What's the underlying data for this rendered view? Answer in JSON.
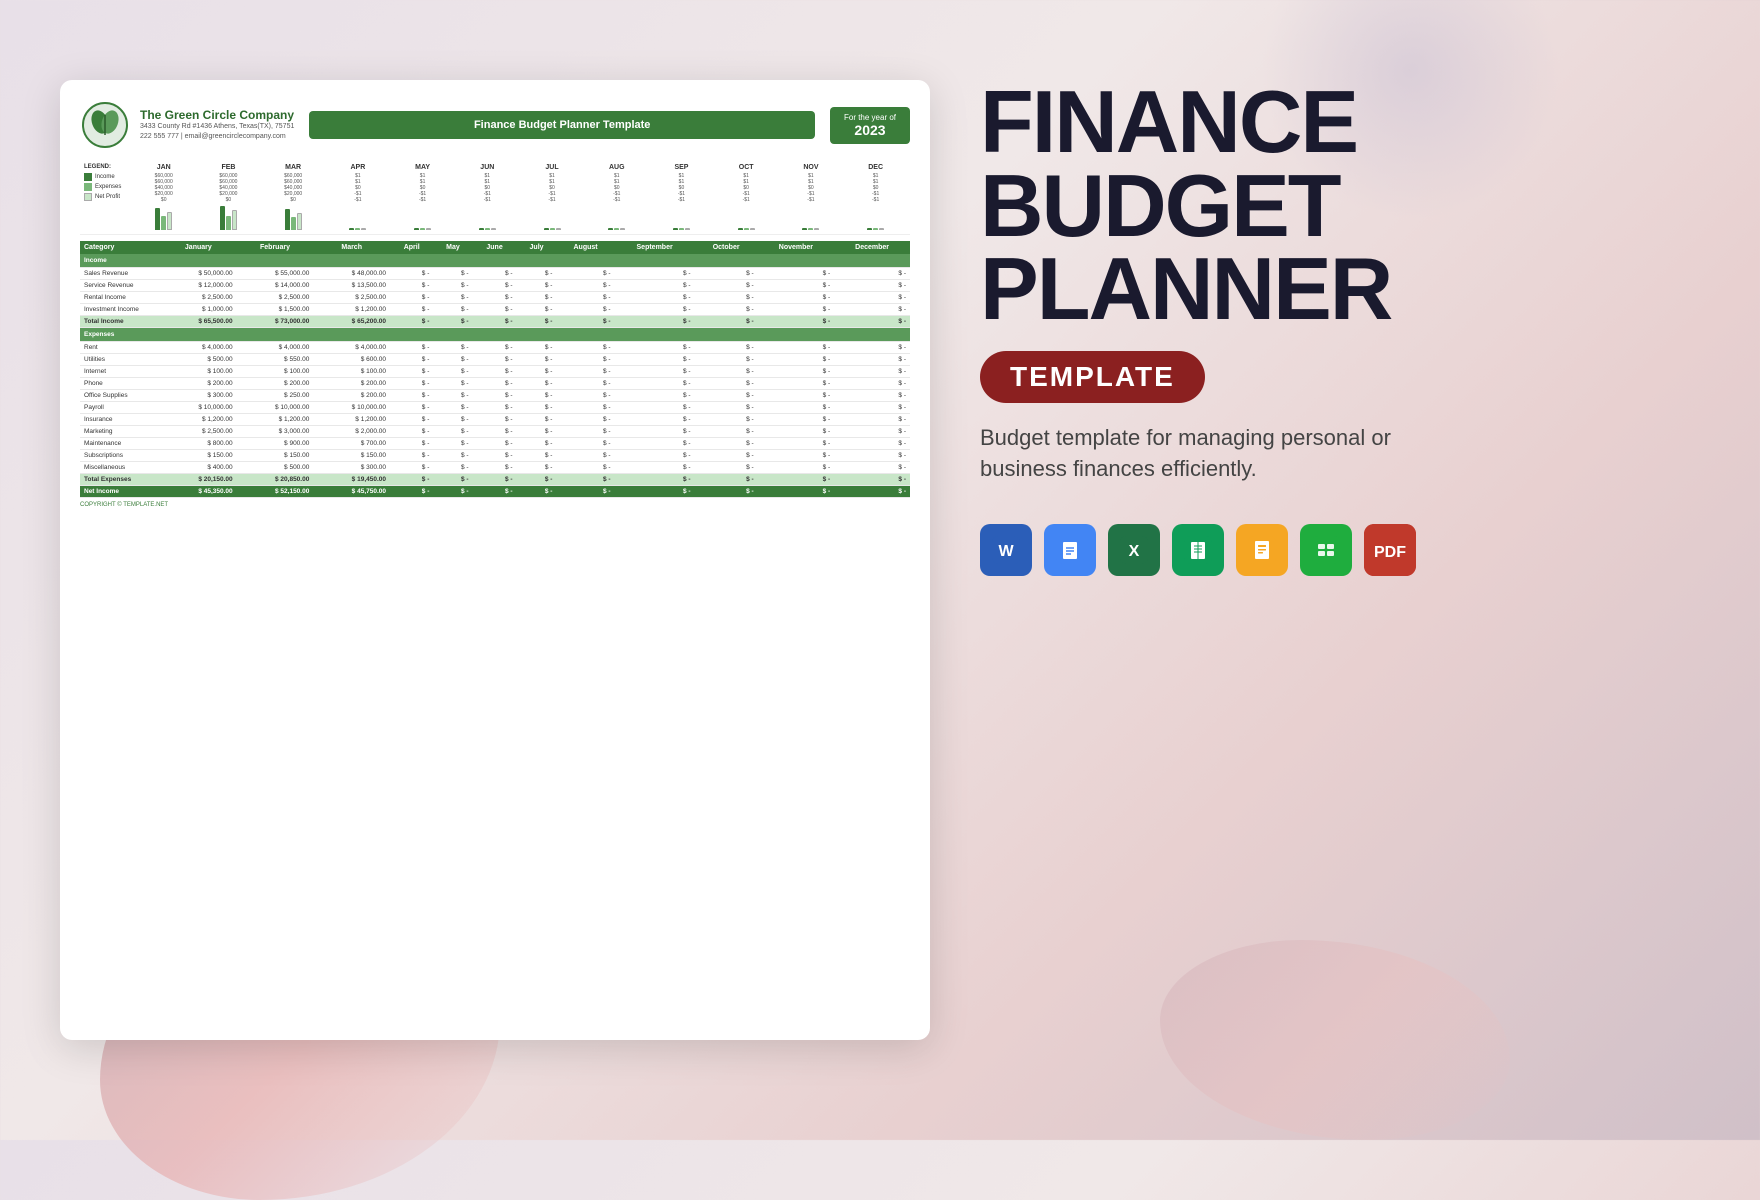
{
  "background": {
    "colors": [
      "#e8e0e8",
      "#f0e8e8",
      "#e8d0d0",
      "#d0c0c8"
    ]
  },
  "company": {
    "name": "The Green Circle Company",
    "address": "3433 County Rd #1436 Athens, Texas(TX), 75751",
    "contact": "222 555 777 | email@greencirclecompany.com"
  },
  "document": {
    "title": "Finance Budget Planner Template",
    "year_label": "For the year of",
    "year": "2023"
  },
  "legend": {
    "items": [
      {
        "label": "Income",
        "color": "#3a7d3a"
      },
      {
        "label": "Expenses",
        "color": "#7ab87a"
      },
      {
        "label": "Net Profit",
        "color": "#c8e6c8"
      }
    ]
  },
  "months": [
    "JAN",
    "FEB",
    "MAR",
    "APR",
    "MAY",
    "JUN",
    "JUL",
    "AUG",
    "SEP",
    "OCT",
    "NOV",
    "DEC"
  ],
  "table": {
    "headers": [
      "Category",
      "January",
      "February",
      "March",
      "April",
      "May",
      "June",
      "July",
      "August",
      "September",
      "October",
      "November",
      "December"
    ],
    "sections": [
      {
        "name": "Income",
        "rows": [
          {
            "category": "Sales Revenue",
            "jan": "$ 50,000.00",
            "feb": "$ 55,000.00",
            "mar": "$ 48,000.00",
            "apr": "$ -",
            "may": "$ -",
            "jun": "$ -",
            "jul": "$ -",
            "aug": "$ -",
            "sep": "$ -",
            "oct": "$ -",
            "nov": "$ -",
            "dec": "$ -"
          },
          {
            "category": "Service Revenue",
            "jan": "$ 12,000.00",
            "feb": "$ 14,000.00",
            "mar": "$ 13,500.00",
            "apr": "$ -",
            "may": "$ -",
            "jun": "$ -",
            "jul": "$ -",
            "aug": "$ -",
            "sep": "$ -",
            "oct": "$ -",
            "nov": "$ -",
            "dec": "$ -"
          },
          {
            "category": "Rental Income",
            "jan": "$ 2,500.00",
            "feb": "$ 2,500.00",
            "mar": "$ 2,500.00",
            "apr": "$ -",
            "may": "$ -",
            "jun": "$ -",
            "jul": "$ -",
            "aug": "$ -",
            "sep": "$ -",
            "oct": "$ -",
            "nov": "$ -",
            "dec": "$ -"
          },
          {
            "category": "Investment Income",
            "jan": "$ 1,000.00",
            "feb": "$ 1,500.00",
            "mar": "$ 1,200.00",
            "apr": "$ -",
            "may": "$ -",
            "jun": "$ -",
            "jul": "$ -",
            "aug": "$ -",
            "sep": "$ -",
            "oct": "$ -",
            "nov": "$ -",
            "dec": "$ -"
          }
        ],
        "total": {
          "label": "Total Income",
          "jan": "$ 65,500.00",
          "feb": "$ 73,000.00",
          "mar": "$ 65,200.00",
          "apr": "$ -",
          "may": "$ -",
          "jun": "$ -",
          "jul": "$ -",
          "aug": "$ -",
          "sep": "$ -",
          "oct": "$ -",
          "nov": "$ -",
          "dec": "$ -"
        }
      },
      {
        "name": "Expenses",
        "rows": [
          {
            "category": "Rent",
            "jan": "$ 4,000.00",
            "feb": "$ 4,000.00",
            "mar": "$ 4,000.00",
            "apr": "$ -",
            "may": "$ -",
            "jun": "$ -",
            "jul": "$ -",
            "aug": "$ -",
            "sep": "$ -",
            "oct": "$ -",
            "nov": "$ -",
            "dec": "$ -"
          },
          {
            "category": "Utilities",
            "jan": "$ 500.00",
            "feb": "$ 550.00",
            "mar": "$ 600.00",
            "apr": "$ -",
            "may": "$ -",
            "jun": "$ -",
            "jul": "$ -",
            "aug": "$ -",
            "sep": "$ -",
            "oct": "$ -",
            "nov": "$ -",
            "dec": "$ -"
          },
          {
            "category": "Internet",
            "jan": "$ 100.00",
            "feb": "$ 100.00",
            "mar": "$ 100.00",
            "apr": "$ -",
            "may": "$ -",
            "jun": "$ -",
            "jul": "$ -",
            "aug": "$ -",
            "sep": "$ -",
            "oct": "$ -",
            "nov": "$ -",
            "dec": "$ -"
          },
          {
            "category": "Phone",
            "jan": "$ 200.00",
            "feb": "$ 200.00",
            "mar": "$ 200.00",
            "apr": "$ -",
            "may": "$ -",
            "jun": "$ -",
            "jul": "$ -",
            "aug": "$ -",
            "sep": "$ -",
            "oct": "$ -",
            "nov": "$ -",
            "dec": "$ -"
          },
          {
            "category": "Office Supplies",
            "jan": "$ 300.00",
            "feb": "$ 250.00",
            "mar": "$ 200.00",
            "apr": "$ -",
            "may": "$ -",
            "jun": "$ -",
            "jul": "$ -",
            "aug": "$ -",
            "sep": "$ -",
            "oct": "$ -",
            "nov": "$ -",
            "dec": "$ -"
          },
          {
            "category": "Payroll",
            "jan": "$ 10,000.00",
            "feb": "$ 10,000.00",
            "mar": "$ 10,000.00",
            "apr": "$ -",
            "may": "$ -",
            "jun": "$ -",
            "jul": "$ -",
            "aug": "$ -",
            "sep": "$ -",
            "oct": "$ -",
            "nov": "$ -",
            "dec": "$ -"
          },
          {
            "category": "Insurance",
            "jan": "$ 1,200.00",
            "feb": "$ 1,200.00",
            "mar": "$ 1,200.00",
            "apr": "$ -",
            "may": "$ -",
            "jun": "$ -",
            "jul": "$ -",
            "aug": "$ -",
            "sep": "$ -",
            "oct": "$ -",
            "nov": "$ -",
            "dec": "$ -"
          },
          {
            "category": "Marketing",
            "jan": "$ 2,500.00",
            "feb": "$ 3,000.00",
            "mar": "$ 2,000.00",
            "apr": "$ -",
            "may": "$ -",
            "jun": "$ -",
            "jul": "$ -",
            "aug": "$ -",
            "sep": "$ -",
            "oct": "$ -",
            "nov": "$ -",
            "dec": "$ -"
          },
          {
            "category": "Maintenance",
            "jan": "$ 800.00",
            "feb": "$ 900.00",
            "mar": "$ 700.00",
            "apr": "$ -",
            "may": "$ -",
            "jun": "$ -",
            "jul": "$ -",
            "aug": "$ -",
            "sep": "$ -",
            "oct": "$ -",
            "nov": "$ -",
            "dec": "$ -"
          },
          {
            "category": "Subscriptions",
            "jan": "$ 150.00",
            "feb": "$ 150.00",
            "mar": "$ 150.00",
            "apr": "$ -",
            "may": "$ -",
            "jun": "$ -",
            "jul": "$ -",
            "aug": "$ -",
            "sep": "$ -",
            "oct": "$ -",
            "nov": "$ -",
            "dec": "$ -"
          },
          {
            "category": "Miscellaneous",
            "jan": "$ 400.00",
            "feb": "$ 500.00",
            "mar": "$ 300.00",
            "apr": "$ -",
            "may": "$ -",
            "jun": "$ -",
            "jul": "$ -",
            "aug": "$ -",
            "sep": "$ -",
            "oct": "$ -",
            "nov": "$ -",
            "dec": "$ -"
          }
        ],
        "total": {
          "label": "Total Expenses",
          "jan": "$ 20,150.00",
          "feb": "$ 20,850.00",
          "mar": "$ 19,450.00",
          "apr": "$ -",
          "may": "$ -",
          "jun": "$ -",
          "jul": "$ -",
          "aug": "$ -",
          "sep": "$ -",
          "oct": "$ -",
          "nov": "$ -",
          "dec": "$ -"
        }
      }
    ],
    "net_income": {
      "label": "Net Income",
      "jan": "$ 45,350.00",
      "feb": "$ 52,150.00",
      "mar": "$ 45,750.00",
      "apr": "$ -",
      "may": "$ -",
      "jun": "$ -",
      "jul": "$ -",
      "aug": "$ -",
      "sep": "$ -",
      "oct": "$ -",
      "nov": "$ -",
      "dec": "$ -"
    }
  },
  "copyright": "COPYRIGHT © TEMPLATE.NET",
  "right_panel": {
    "title_line1": "FINANCE",
    "title_line2": "BUDGET",
    "title_line3": "PLANNER",
    "badge": "TEMPLATE",
    "description": "Budget template for managing personal or business finances efficiently."
  },
  "format_icons": [
    {
      "label": "W",
      "type": "word",
      "title": "Word"
    },
    {
      "label": "≡",
      "type": "docs",
      "title": "Google Docs"
    },
    {
      "label": "X",
      "type": "excel",
      "title": "Excel"
    },
    {
      "label": "⊞",
      "type": "sheets",
      "title": "Google Sheets"
    },
    {
      "label": "✎",
      "type": "pages",
      "title": "Pages"
    },
    {
      "label": "⬛",
      "type": "numbers",
      "title": "Numbers"
    },
    {
      "label": "PDF",
      "type": "pdf",
      "title": "PDF"
    }
  ]
}
